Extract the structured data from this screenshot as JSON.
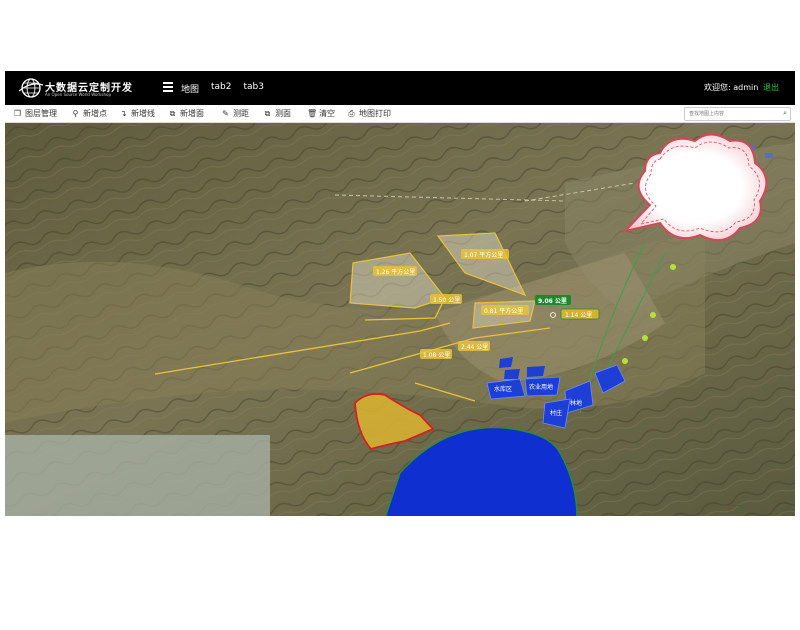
{
  "header": {
    "logo_title": "大数据云定制开发",
    "logo_subtitle": "An Open Source World Workshop",
    "nav": [
      "地图",
      "tab2",
      "tab3"
    ],
    "welcome": "欢迎您: admin",
    "logout": "退出"
  },
  "toolbar": {
    "items": [
      {
        "icon": "layers-icon",
        "label": "图层管理"
      },
      {
        "icon": "map-pin-icon",
        "label": "新增点"
      },
      {
        "icon": "polyline-icon",
        "label": "新增线"
      },
      {
        "icon": "polygon-icon",
        "label": "新增面"
      },
      {
        "icon": "ruler-icon",
        "label": "测距"
      },
      {
        "icon": "area-measure-icon",
        "label": "测面"
      },
      {
        "icon": "trash-icon",
        "label": "清空"
      },
      {
        "icon": "print-icon",
        "label": "地图打印"
      }
    ],
    "search_placeholder": "查找地图上内容"
  },
  "map": {
    "yellow_polygon_labels": [
      "1.26 平方公里",
      "1.07 平方公里",
      "0.81 平方公里"
    ],
    "distance_labels": [
      "1.50 公里",
      "2.44 公里",
      "1.08 公里"
    ],
    "active_distance": "9.06 公里",
    "green_distance": "1.14 公里",
    "blue_area_labels": [
      "水库区",
      "农业用地",
      "林地",
      "村庄"
    ],
    "colors": {
      "measure_yellow": "#e8c23a",
      "lake_blue": "#0f2fd0",
      "boundary_red": "#d42020",
      "active_green": "#1c8a2a"
    }
  }
}
